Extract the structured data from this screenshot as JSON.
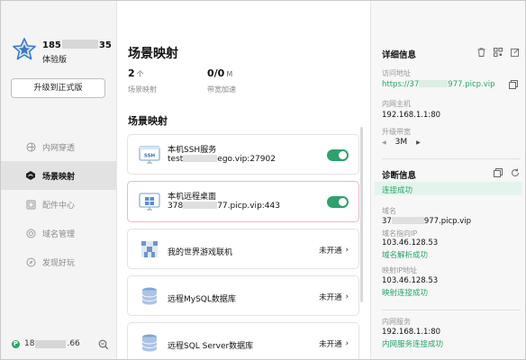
{
  "user": {
    "phone_prefix": "185",
    "phone_suffix": "35",
    "plan": "体验版",
    "upgrade_label": "升级到正式版"
  },
  "nav": [
    {
      "label": "内网穿透",
      "icon": "tunnel-icon",
      "active": false
    },
    {
      "label": "场景映射",
      "icon": "scene-icon",
      "active": true
    },
    {
      "label": "配件中心",
      "icon": "accessory-icon",
      "active": false
    },
    {
      "label": "域名管理",
      "icon": "domain-icon",
      "active": false
    },
    {
      "label": "发现好玩",
      "icon": "discover-icon",
      "active": false
    }
  ],
  "footer": {
    "ip_prefix": "18",
    "ip_suffix": ".66"
  },
  "main": {
    "title": "场景映射",
    "stats": [
      {
        "value": "2",
        "unit": "个",
        "label": "场景映射"
      },
      {
        "value": "0/0",
        "unit": "M",
        "label": "带宽加速"
      }
    ],
    "section_title": "场景映射",
    "cards": [
      {
        "name": "本机SSH服务",
        "addr_prefix": "test",
        "addr_suffix": "ego.vip:27902",
        "enabled": true,
        "status": ""
      },
      {
        "name": "本机远程桌面",
        "addr_prefix": "378",
        "addr_suffix": "77.picp.vip:443",
        "enabled": true,
        "status": ""
      },
      {
        "name": "我的世界游戏联机",
        "addr_prefix": "",
        "addr_suffix": "",
        "enabled": false,
        "status": "未开通"
      },
      {
        "name": "远程MySQL数据库",
        "addr_prefix": "",
        "addr_suffix": "",
        "enabled": false,
        "status": "未开通"
      },
      {
        "name": "远程SQL Server数据库",
        "addr_prefix": "",
        "addr_suffix": "",
        "enabled": false,
        "status": "未开通"
      }
    ]
  },
  "detail": {
    "title": "详细信息",
    "access_label": "访问地址",
    "access_prefix": "https://37",
    "access_suffix": "977.picp.vip",
    "host_label": "内网主机",
    "host_value": "192.168.1.1:80",
    "bandwidth_label": "升级带宽",
    "bandwidth_value": "3M",
    "diag_title": "诊断信息",
    "diag_status": "连接成功",
    "domain_label": "域名",
    "domain_prefix": "37",
    "domain_suffix": "977.picp.vip",
    "domain_ip_label": "域名指向IP",
    "domain_ip_value": "103.46.128.53",
    "domain_ok": "域名解析成功",
    "map_ip_label": "映射IP地址",
    "map_ip_value": "103.46.128.53",
    "map_ok": "映射连接成功",
    "service_label": "内网服务",
    "service_value": "192.168.1.1:80",
    "service_ok": "内网服务连接成功"
  },
  "colors": {
    "accent": "#27a56a",
    "selected_border": "#efb8c2"
  }
}
